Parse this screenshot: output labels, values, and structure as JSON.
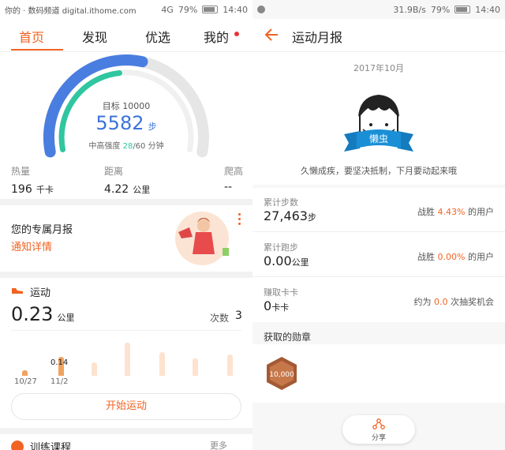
{
  "left": {
    "status": {
      "carrier": "你的 · 数码频道 digital.ithome.com",
      "signal": "4G",
      "battery": "79%",
      "time": "14:40"
    },
    "tabs": [
      "首页",
      "发现",
      "优选",
      "我的"
    ],
    "ring": {
      "goal_label": "目标 10000",
      "steps": "5582",
      "steps_unit": "步",
      "intensity_prefix": "中高强度 ",
      "intensity_value": "28",
      "intensity_suffix": "/60 分钟",
      "outer_fraction": 0.56,
      "inner_fraction": 0.47
    },
    "stats": [
      {
        "label": "热量",
        "value": "196",
        "unit": "千卡"
      },
      {
        "label": "距离",
        "value": "4.22",
        "unit": "公里"
      },
      {
        "label": "爬高",
        "value": "--",
        "unit": ""
      }
    ],
    "report": {
      "title": "您的专属月报",
      "link": "通知详情"
    },
    "sport": {
      "title": "运动",
      "distance": "0.23",
      "unit": "公里",
      "count_label": "次数",
      "count": "3",
      "bar_label": "0.14",
      "dates": [
        "10/27",
        "11/2"
      ],
      "bars": [
        {
          "value": 0.04,
          "active": true
        },
        {
          "value": 0.14,
          "active": true
        },
        {
          "value": 0.1,
          "active": false
        },
        {
          "value": 0.25,
          "active": false
        },
        {
          "value": 0.18,
          "active": false
        },
        {
          "value": 0.13,
          "active": false
        },
        {
          "value": 0.16,
          "active": false
        }
      ],
      "start_button": "开始运动"
    },
    "training": {
      "title": "训练课程",
      "more": "更多"
    }
  },
  "right": {
    "status": {
      "speed": "31.9B/s",
      "battery": "79%",
      "time": "14:40"
    },
    "header": {
      "title": "运动月报"
    },
    "month": "2017年10月",
    "badge": {
      "ribbon": "懒虫",
      "quote": "久懒成疾，要坚决抵制，下月要动起来哦"
    },
    "rows": [
      {
        "label": "累计步数",
        "value": "27,463",
        "unit": "步",
        "prefix": "战胜 ",
        "highlight": "4.43%",
        "suffix": " 的用户"
      },
      {
        "label": "累计跑步",
        "value": "0.00",
        "unit": "公里",
        "prefix": "战胜 ",
        "highlight": "0.00%",
        "suffix": " 的用户"
      },
      {
        "label": "赚取卡卡",
        "value": "0",
        "unit": "卡卡",
        "prefix": "约为 ",
        "highlight": "0.0",
        "suffix": " 次抽奖机会"
      }
    ],
    "medals_title": "获取的勋章",
    "medal_text": "10,000",
    "share_label": "分享",
    "colors": {
      "accent": "#f26322",
      "ring_blue": "#4a7de0",
      "ring_green": "#2fc6a0",
      "ribbon": "#1a8fd6"
    }
  }
}
